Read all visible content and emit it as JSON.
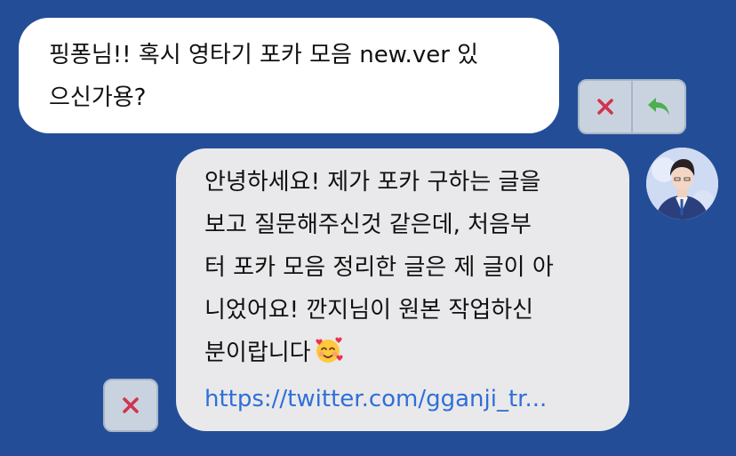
{
  "incoming_message": {
    "lines": [
      "핑퐁님!! 혹시 영타기 포카 모음 new.ver 있",
      "으신가용?"
    ]
  },
  "outgoing_message": {
    "lines": [
      "안녕하세요! 제가 포카 구하는 글을",
      "보고 질문해주신것 같은데, 처음부",
      "터 포카 모음 정리한 글은 제 글이 아",
      "니었어요! 깐지님이 원본 작업하신",
      "분이랍니다"
    ],
    "emoji": "smiling-face-with-hearts",
    "link_text": "https://twitter.com/gganji_tr..."
  },
  "actions": {
    "delete_icon": "close-icon",
    "reply_icon": "reply-arrow-icon"
  },
  "colors": {
    "background": "#234e97",
    "incoming_bubble": "#ffffff",
    "outgoing_bubble": "#e9e9eb",
    "link": "#2f6fd8",
    "delete": "#d1334f",
    "reply": "#4caf50"
  }
}
